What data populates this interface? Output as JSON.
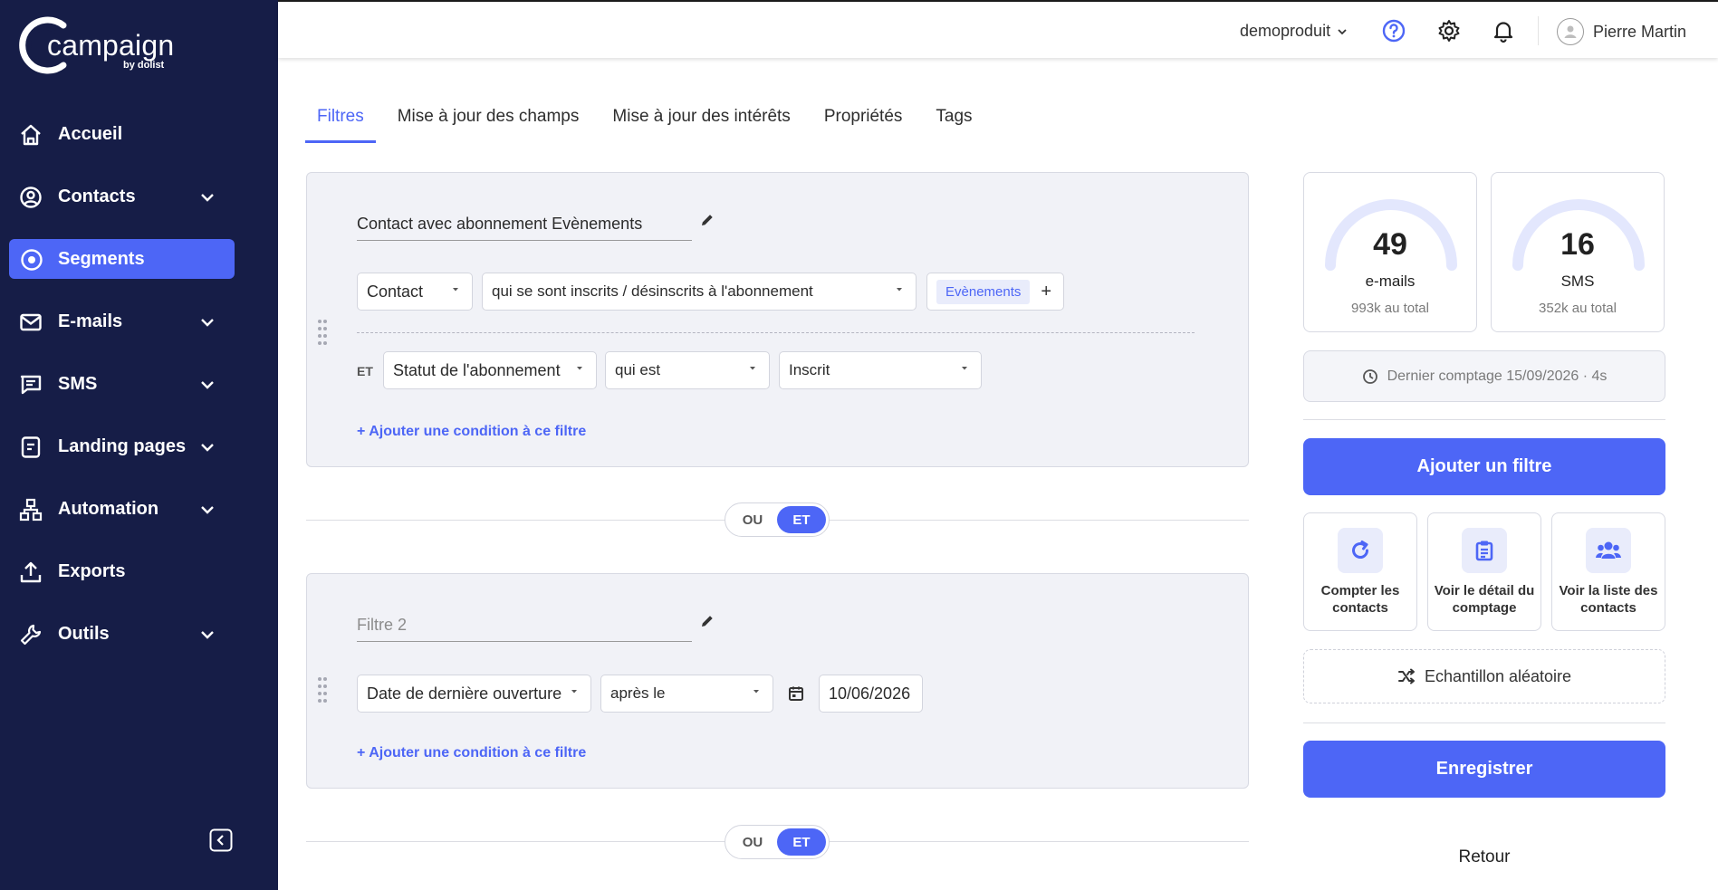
{
  "brand": {
    "name": "campaign",
    "sub": "by dolist"
  },
  "sidebar": {
    "items": [
      {
        "label": "Accueil",
        "icon": "home-icon",
        "expandable": false
      },
      {
        "label": "Contacts",
        "icon": "user-circle-icon",
        "expandable": true
      },
      {
        "label": "Segments",
        "icon": "target-icon",
        "expandable": false,
        "active": true
      },
      {
        "label": "E-mails",
        "icon": "mail-icon",
        "expandable": true
      },
      {
        "label": "SMS",
        "icon": "message-icon",
        "expandable": true
      },
      {
        "label": "Landing pages",
        "icon": "page-icon",
        "expandable": true
      },
      {
        "label": "Automation",
        "icon": "workflow-icon",
        "expandable": true
      },
      {
        "label": "Exports",
        "icon": "upload-icon",
        "expandable": false
      },
      {
        "label": "Outils",
        "icon": "wrench-icon",
        "expandable": true
      }
    ]
  },
  "topbar": {
    "org": "demoproduit",
    "user": "Pierre Martin"
  },
  "tabs": [
    {
      "label": "Filtres",
      "active": true
    },
    {
      "label": "Mise à jour des champs"
    },
    {
      "label": "Mise à jour des intérêts"
    },
    {
      "label": "Propriétés"
    },
    {
      "label": "Tags"
    }
  ],
  "filter1": {
    "name": "Contact avec abonnement Evènements",
    "type": "Contact",
    "condition": "qui se sont inscrits / désinscrits à l'abonnement",
    "tag": "Evènements",
    "and_label": "ET",
    "sub_field": "Statut de l'abonnement",
    "sub_operator": "qui est",
    "sub_value": "Inscrit",
    "add_condition": "+ Ajouter une condition à ce filtre"
  },
  "switch1": {
    "or": "OU",
    "and": "ET",
    "selected": "ET"
  },
  "filter2": {
    "name_placeholder": "Filtre 2",
    "field": "Date de dernière ouverture",
    "operator": "après le",
    "date": "10/06/2026",
    "add_condition": "+ Ajouter une condition à ce filtre"
  },
  "switch2": {
    "or": "OU",
    "and": "ET",
    "selected": "ET"
  },
  "stats": {
    "emails": {
      "value": "49",
      "label": "e-mails",
      "total": "993k au total"
    },
    "sms": {
      "value": "16",
      "label": "SMS",
      "total": "352k au total"
    }
  },
  "last_count": "Dernier comptage 15/09/2026 · 4s",
  "actions": {
    "add_filter": "Ajouter un filtre",
    "count": "Compter les contacts",
    "detail": "Voir le détail du comptage",
    "list": "Voir la liste des contacts",
    "random": "Echantillon aléatoire",
    "save": "Enregistrer",
    "back": "Retour"
  },
  "colors": {
    "sidebar": "#161d47",
    "accent": "#4d66f6",
    "chip": "#e9ecfb"
  }
}
